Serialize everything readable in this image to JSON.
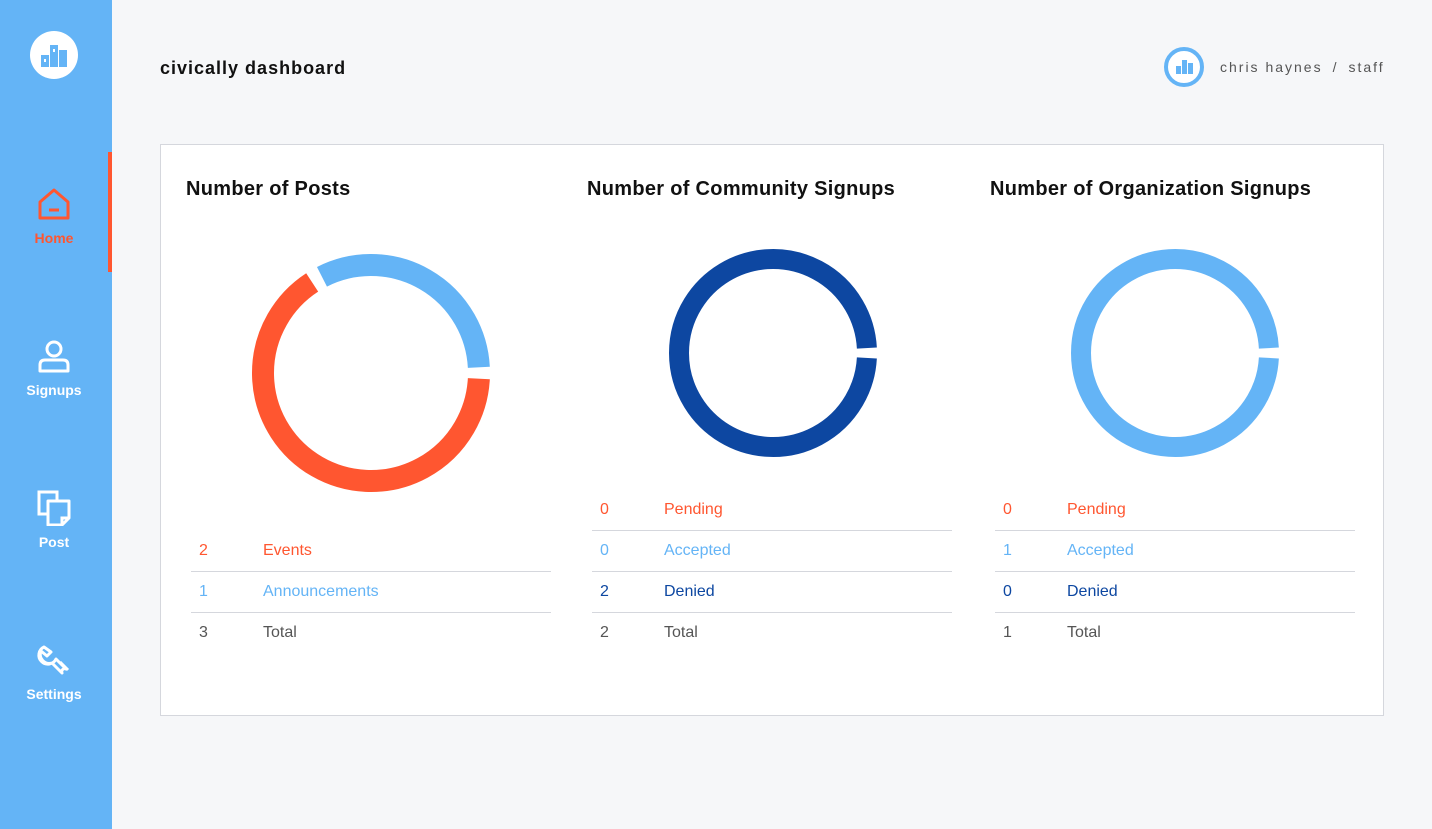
{
  "app": {
    "title": "civically dashboard"
  },
  "user": {
    "name": "chris haynes",
    "separator": "/",
    "role": "staff"
  },
  "colors": {
    "sidebar": "#64b4f6",
    "accent": "#ff5630",
    "light_blue": "#64b4f6",
    "dark_blue": "#0d47a1",
    "text": "#555555"
  },
  "sidebar": {
    "logo_icon": "city-buildings-icon",
    "items": [
      {
        "label": "Home",
        "icon": "home-icon",
        "active": true
      },
      {
        "label": "Signups",
        "icon": "user-icon",
        "active": false
      },
      {
        "label": "Post",
        "icon": "documents-icon",
        "active": false
      },
      {
        "label": "Settings",
        "icon": "wrench-icon",
        "active": false
      }
    ]
  },
  "panels": [
    {
      "title": "Number of Posts",
      "rows": [
        {
          "value": "2",
          "label": "Events"
        },
        {
          "value": "1",
          "label": "Announcements"
        },
        {
          "value": "3",
          "label": "Total"
        }
      ]
    },
    {
      "title": "Number of Community Signups",
      "rows": [
        {
          "value": "0",
          "label": "Pending"
        },
        {
          "value": "0",
          "label": "Accepted"
        },
        {
          "value": "2",
          "label": "Denied"
        },
        {
          "value": "2",
          "label": "Total"
        }
      ]
    },
    {
      "title": "Number of Organization Signups",
      "rows": [
        {
          "value": "0",
          "label": "Pending"
        },
        {
          "value": "1",
          "label": "Accepted"
        },
        {
          "value": "0",
          "label": "Denied"
        },
        {
          "value": "1",
          "label": "Total"
        }
      ]
    }
  ],
  "chart_data": [
    {
      "type": "pie",
      "categories": [
        "Events",
        "Announcements"
      ],
      "values": [
        2,
        1
      ],
      "colors": [
        "#ff5630",
        "#64b4f6"
      ]
    },
    {
      "type": "pie",
      "categories": [
        "Pending",
        "Accepted",
        "Denied"
      ],
      "values": [
        0,
        0,
        2
      ],
      "colors": [
        "#ff5630",
        "#64b4f6",
        "#0d47a1"
      ]
    },
    {
      "type": "pie",
      "categories": [
        "Pending",
        "Accepted",
        "Denied"
      ],
      "values": [
        0,
        1,
        0
      ],
      "colors": [
        "#ff5630",
        "#64b4f6",
        "#0d47a1"
      ]
    }
  ]
}
